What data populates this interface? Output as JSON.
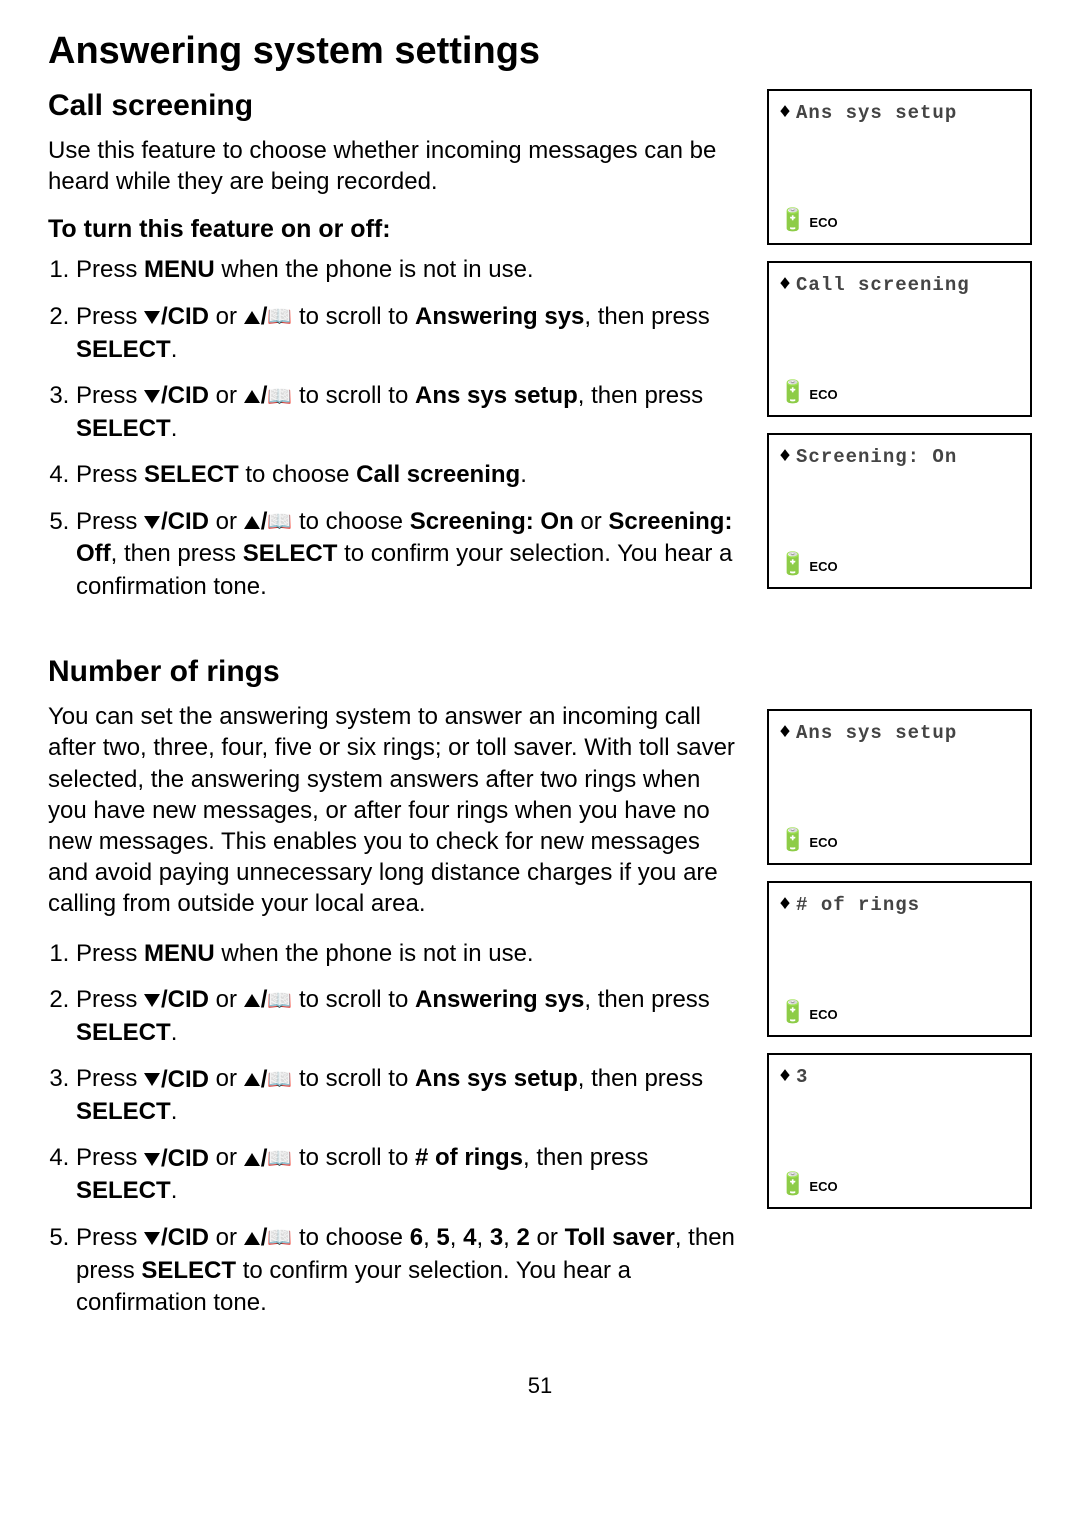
{
  "title": "Answering system settings",
  "section1": {
    "heading": "Call screening",
    "intro": "Use this feature to choose whether incoming messages can be heard while they are being recorded.",
    "subheading": "To turn this feature on or off:",
    "steps": {
      "s1a": "Press ",
      "s1b": "MENU",
      "s1c": " when the phone is not in use.",
      "s2a": "Press ",
      "s2b": "/CID",
      "s2c": " or ",
      "s2d": "/",
      "s2e": " to scroll to ",
      "s2f": "Answering sys",
      "s2g": ", then press ",
      "s2h": "SELECT",
      "s2i": ".",
      "s3a": "Press ",
      "s3b": "/CID",
      "s3c": " or ",
      "s3d": "/",
      "s3e": " to scroll to ",
      "s3f": "Ans sys setup",
      "s3g": ", then press ",
      "s3h": "SELECT",
      "s3i": ".",
      "s4a": "Press ",
      "s4b": "SELECT",
      "s4c": " to choose ",
      "s4d": "Call screening",
      "s4e": ".",
      "s5a": "Press ",
      "s5b": "/CID",
      "s5c": " or ",
      "s5d": "/",
      "s5e": " to choose ",
      "s5f": "Screening: On",
      "s5g": " or ",
      "s5h": "Screening: Off",
      "s5i": ", then press ",
      "s5j": "SELECT",
      "s5k": " to confirm your selection. You hear a confirmation tone."
    }
  },
  "section2": {
    "heading": "Number of rings",
    "intro": "You can set the answering system to answer an incoming call after two, three, four, five or six rings; or toll saver. With toll saver selected, the answering system answers after two rings when you have new messages, or after four rings when you have no new messages. This enables you to check for new messages and avoid paying unnecessary long distance charges if you are calling from outside your local area.",
    "steps": {
      "s1a": "Press ",
      "s1b": "MENU",
      "s1c": " when the phone is not in use.",
      "s2a": "Press ",
      "s2b": "/CID",
      "s2c": " or ",
      "s2d": "/",
      "s2e": " to scroll to ",
      "s2f": "Answering sys",
      "s2g": ", then press ",
      "s2h": "SELECT",
      "s2i": ".",
      "s3a": "Press ",
      "s3b": "/CID",
      "s3c": " or ",
      "s3d": "/",
      "s3e": " to scroll to ",
      "s3f": "Ans sys setup",
      "s3g": ", then press ",
      "s3h": "SELECT",
      "s3i": ".",
      "s4a": "Press ",
      "s4b": "/CID",
      "s4c": " or ",
      "s4d": "/",
      "s4e": " to scroll to ",
      "s4f": "# of rings",
      "s4g": ", then press ",
      "s4h": "SELECT",
      "s4i": ".",
      "s5a": "Press ",
      "s5b": "/CID",
      "s5c": " or ",
      "s5d": "/",
      "s5e": " to choose ",
      "s5f": "6",
      "s5g": ", ",
      "s5h": "5",
      "s5i": ", ",
      "s5j": "4",
      "s5k": ", ",
      "s5l": "3",
      "s5m": ", ",
      "s5n": "2",
      "s5o": " or ",
      "s5p": "Toll saver",
      "s5q": ", then press ",
      "s5r": "SELECT",
      "s5s": " to confirm your selection. You hear a confirmation tone."
    }
  },
  "lcds": {
    "l1": "Ans sys setup",
    "l2": "Call screening",
    "l3": "Screening: On",
    "l4": "Ans sys setup",
    "l5": "# of rings",
    "l6": "3",
    "eco": "ECO"
  },
  "page_number": "51"
}
